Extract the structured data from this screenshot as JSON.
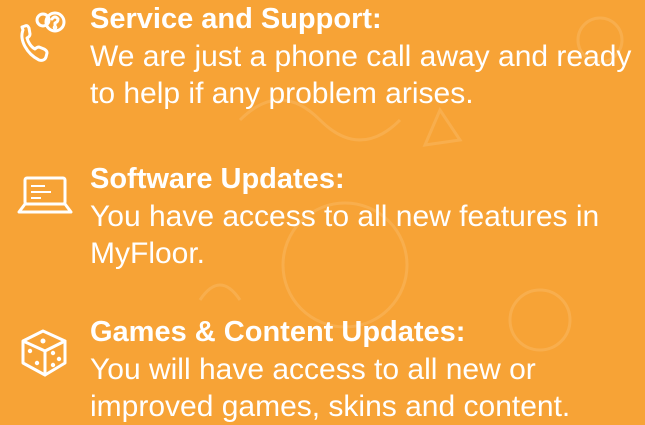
{
  "theme": {
    "background": "#f7a336",
    "text": "#ffffff",
    "doodle": "#f9b65d"
  },
  "features": [
    {
      "icon": "phone-support-icon",
      "title": "Service and Support:",
      "description": "We are just a phone call away and ready to help if any problem arises."
    },
    {
      "icon": "software-update-laptop-icon",
      "title": "Software Updates:",
      "description": "You have access to all new features in MyFloor."
    },
    {
      "icon": "dice-games-icon",
      "title": "Games & Content Updates:",
      "description": "You will have access to all new or improved games, skins and content."
    }
  ]
}
